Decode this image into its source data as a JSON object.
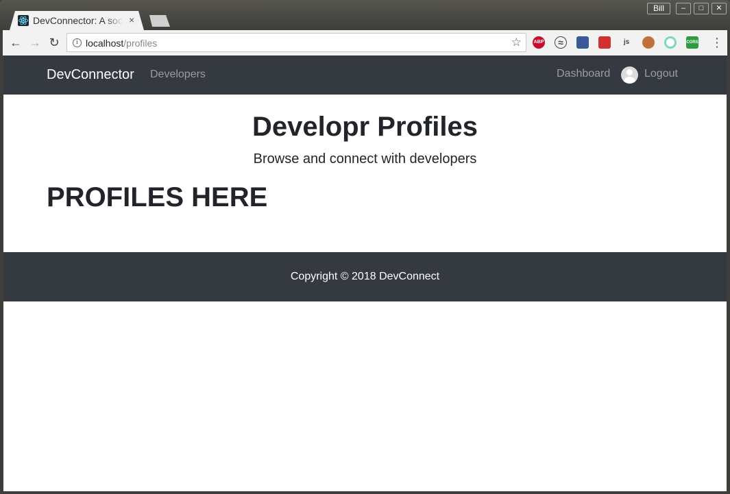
{
  "browser": {
    "tab_title": "DevConnector: A social network for developers",
    "tab_close": "×",
    "user_name": "Bill",
    "window_controls": {
      "minimize": "–",
      "maximize": "□",
      "close": "✕"
    },
    "url_host": "localhost",
    "url_path": "/profiles",
    "extensions": [
      {
        "name": "adblock-plus-icon",
        "label": "ABP",
        "color": "#c70d2c"
      },
      {
        "name": "sync-icon",
        "label": "",
        "color": "#f2f2f2"
      },
      {
        "name": "colorpicker-icon",
        "label": "",
        "color": "#3b5998"
      },
      {
        "name": "redux-devtools-icon",
        "label": "",
        "color": "#d32f2f"
      },
      {
        "name": "nodejs-icon",
        "label": "js",
        "color": "#f2f2f2"
      },
      {
        "name": "tampermonkey-icon",
        "label": "",
        "color": "#c0703a"
      },
      {
        "name": "react-devtools-icon",
        "label": "",
        "color": "#7fd8b4"
      },
      {
        "name": "cors-icon",
        "label": "CORS",
        "color": "#2e9b3e"
      }
    ]
  },
  "navbar": {
    "brand": "DevConnector",
    "developers_link": "Developers",
    "dashboard_link": "Dashboard",
    "logout_link": "Logout"
  },
  "main": {
    "title": "Developr Profiles",
    "lead": "Browse and connect with developers",
    "placeholder": "PROFILES HERE"
  },
  "footer": {
    "copyright": "Copyright © 2018 DevConnect"
  },
  "colors": {
    "navbar_bg": "#343a40",
    "nav_link": "#9a9da1",
    "text": "#212529"
  }
}
